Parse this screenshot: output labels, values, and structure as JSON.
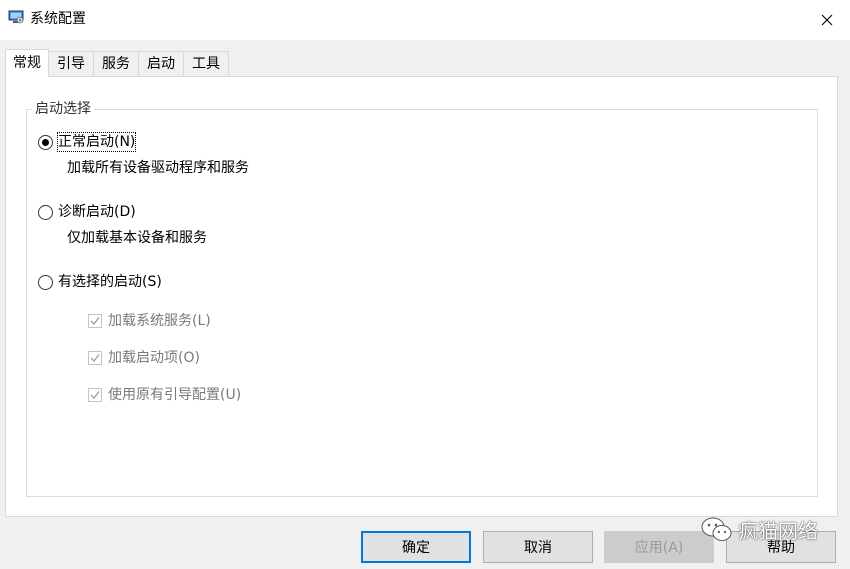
{
  "window": {
    "title": "系统配置",
    "icon": "monitor-settings-icon",
    "close_icon": "close-icon"
  },
  "tabs": [
    {
      "label": "常规",
      "active": true
    },
    {
      "label": "引导",
      "active": false
    },
    {
      "label": "服务",
      "active": false
    },
    {
      "label": "启动",
      "active": false
    },
    {
      "label": "工具",
      "active": false
    }
  ],
  "startup_group": {
    "legend": "启动选择",
    "options": [
      {
        "label": "正常启动(N)",
        "description": "加载所有设备驱动程序和服务",
        "checked": true
      },
      {
        "label": "诊断启动(D)",
        "description": "仅加载基本设备和服务",
        "checked": false
      },
      {
        "label": "有选择的启动(S)",
        "checked": false
      }
    ],
    "selective_items": [
      {
        "label": "加载系统服务(L)",
        "checked": true,
        "enabled": false
      },
      {
        "label": "加载启动项(O)",
        "checked": true,
        "enabled": false
      },
      {
        "label": "使用原有引导配置(U)",
        "checked": true,
        "enabled": false
      }
    ]
  },
  "buttons": {
    "ok": "确定",
    "cancel": "取消",
    "apply": "应用(A)",
    "help": "帮助"
  },
  "watermark": {
    "text": "疯猫网络",
    "icon": "wechat-icon"
  },
  "colors": {
    "accent": "#0078d7",
    "titlebar": "#ffffff",
    "dialog_bg": "#f0f0f0"
  }
}
